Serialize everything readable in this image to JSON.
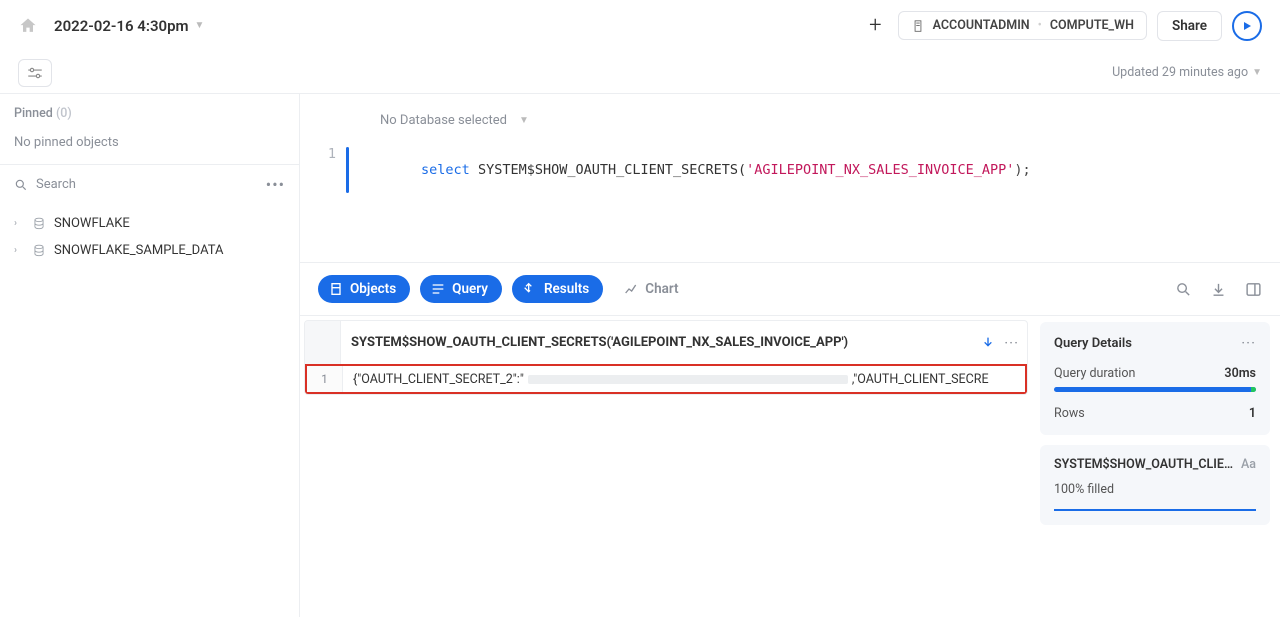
{
  "header": {
    "worksheet_name": "2022-02-16 4:30pm",
    "role": "ACCOUNTADMIN",
    "warehouse": "COMPUTE_WH",
    "share_label": "Share"
  },
  "subheader": {
    "updated_text": "Updated 29 minutes ago"
  },
  "sidebar": {
    "pinned_label": "Pinned",
    "pinned_count": "(0)",
    "pinned_empty": "No pinned objects",
    "search_label": "Search",
    "tree": [
      {
        "label": "SNOWFLAKE"
      },
      {
        "label": "SNOWFLAKE_SAMPLE_DATA"
      }
    ]
  },
  "editor": {
    "db_select": "No Database selected",
    "line_no": "1",
    "code": {
      "kw": "select",
      "fn": " SYSTEM$SHOW_OAUTH_CLIENT_SECRETS(",
      "arg": "'AGILEPOINT_NX_SALES_INVOICE_APP'",
      "close": ");"
    }
  },
  "tabs": {
    "objects": "Objects",
    "query": "Query",
    "results": "Results",
    "chart": "Chart"
  },
  "result": {
    "column": "SYSTEM$SHOW_OAUTH_CLIENT_SECRETS('AGILEPOINT_NX_SALES_INVOICE_APP')",
    "row_no": "1",
    "cell_prefix": "{\"OAUTH_CLIENT_SECRET_2\":\"",
    "cell_suffix": ",\"OAUTH_CLIENT_SECRE"
  },
  "details": {
    "title": "Query Details",
    "duration_label": "Query duration",
    "duration_value": "30ms",
    "rows_label": "Rows",
    "rows_value": "1",
    "col_short": "SYSTEM$SHOW_OAUTH_CLIENT_SE...",
    "type_badge": "Aa",
    "filled": "100% filled"
  }
}
